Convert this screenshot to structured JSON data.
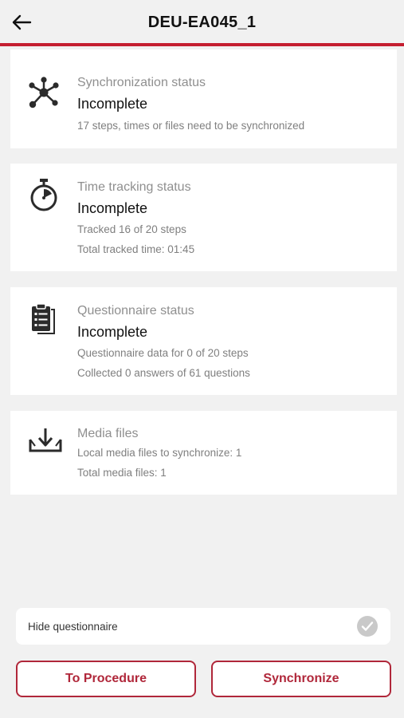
{
  "header": {
    "title": "DEU-EA045_1",
    "back_icon": "arrow-left-icon",
    "accent_color": "#c41e30"
  },
  "cards": {
    "sync": {
      "icon": "network-nodes-icon",
      "label": "Synchronization status",
      "status": "Incomplete",
      "details": [
        "17 steps, times or files need to be synchronized"
      ]
    },
    "time": {
      "icon": "stopwatch-icon",
      "label": "Time tracking status",
      "status": "Incomplete",
      "details": [
        "Tracked 16 of 20 steps",
        "Total tracked time: 01:45"
      ]
    },
    "questionnaire": {
      "icon": "clipboard-list-icon",
      "label": "Questionnaire status",
      "status": "Incomplete",
      "details": [
        "Questionnaire data for 0 of 20 steps",
        "Collected 0 answers of 61 questions"
      ]
    },
    "media": {
      "icon": "tray-download-icon",
      "label": "Media files",
      "details": [
        "Local media files to synchronize: 1",
        "Total media files: 1"
      ]
    }
  },
  "toggle": {
    "label": "Hide questionnaire",
    "checked": false
  },
  "buttons": {
    "procedure": "To Procedure",
    "synchronize": "Synchronize",
    "color": "#b0273a"
  }
}
